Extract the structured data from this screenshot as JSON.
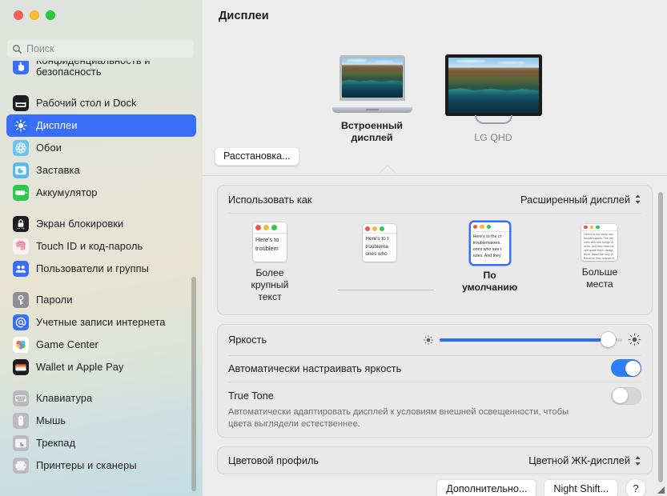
{
  "window": {
    "traffic_lights": [
      "close",
      "minimize",
      "zoom"
    ],
    "colors": {
      "accent": "#3b6ef6",
      "slider": "#2f6ef0",
      "toggle_on": "#2f7ef5"
    }
  },
  "search": {
    "placeholder": "Поиск",
    "value": "",
    "icon": "search-icon"
  },
  "sidebar": {
    "groups": [
      {
        "items": [
          {
            "label": "Конфиденциальность и безопасность",
            "icon": "hand-raised-icon",
            "selected": false,
            "clipped": true
          }
        ]
      },
      {
        "items": [
          {
            "label": "Рабочий стол и Dock",
            "icon": "dock-icon",
            "selected": false
          },
          {
            "label": "Дисплеи",
            "icon": "brightness-icon",
            "selected": true
          },
          {
            "label": "Обои",
            "icon": "wallpaper-icon",
            "selected": false
          },
          {
            "label": "Заставка",
            "icon": "screensaver-icon",
            "selected": false
          },
          {
            "label": "Аккумулятор",
            "icon": "battery-icon",
            "selected": false
          }
        ]
      },
      {
        "items": [
          {
            "label": "Экран блокировки",
            "icon": "lock-screen-icon",
            "selected": false
          },
          {
            "label": "Touch ID и код-пароль",
            "icon": "touch-id-icon",
            "selected": false
          },
          {
            "label": "Пользователи и группы",
            "icon": "users-icon",
            "selected": false
          }
        ]
      },
      {
        "items": [
          {
            "label": "Пароли",
            "icon": "key-icon",
            "selected": false
          },
          {
            "label": "Учетные записи интернета",
            "icon": "at-sign-icon",
            "selected": false
          },
          {
            "label": "Game Center",
            "icon": "game-center-icon",
            "selected": false
          },
          {
            "label": "Wallet и Apple Pay",
            "icon": "wallet-icon",
            "selected": false
          }
        ]
      },
      {
        "items": [
          {
            "label": "Клавиатура",
            "icon": "keyboard-icon",
            "selected": false
          },
          {
            "label": "Мышь",
            "icon": "mouse-icon",
            "selected": false
          },
          {
            "label": "Трекпад",
            "icon": "trackpad-icon",
            "selected": false
          },
          {
            "label": "Принтеры и сканеры",
            "icon": "printer-icon",
            "selected": false
          }
        ]
      }
    ]
  },
  "main": {
    "title": "Дисплеи",
    "arrange_button": "Расстановка...",
    "displays": [
      {
        "name": "Встроенный дисплей",
        "type": "laptop",
        "active": true
      },
      {
        "name": "LG QHD",
        "type": "monitor",
        "active": false
      }
    ],
    "use_as": {
      "label": "Использовать как",
      "value": "Расширенный дисплей",
      "options": [
        "Расширенный дисплей"
      ]
    },
    "scale_options": [
      {
        "caption": "Более\nкрупный\nтекст",
        "selected": false,
        "preview_text": "Here's to\ntroublem",
        "size": "xl"
      },
      {
        "caption": "",
        "selected": false,
        "preview_text": "Here's to t\ntroublema\nones who",
        "size": "l"
      },
      {
        "caption": "По умолчанию",
        "selected": true,
        "preview_text": "Here's to the cr\ntroublemakers.\nones who see t\nrules. And they",
        "size": "m"
      },
      {
        "caption": "Больше\nместа",
        "selected": false,
        "preview_text": "Here's to the crazy one\ntroublemakers. The rou\nones who see things di\nrules. And they have no\ncan quote them, disagr\nthem. About the only th\nBecause they change th",
        "size": "s"
      }
    ],
    "brightness": {
      "label": "Яркость",
      "value": 96,
      "min": 0,
      "max": 100,
      "icon_low": "sun-small-icon",
      "icon_high": "sun-large-icon"
    },
    "auto_brightness": {
      "label": "Автоматически настраивать яркость",
      "on": true
    },
    "true_tone": {
      "label": "True Tone",
      "description": "Автоматически адаптировать дисплей к условиям внешней освещенности, чтобы цвета выглядели естественнее.",
      "on": false
    },
    "color_profile": {
      "label": "Цветовой профиль",
      "value": "Цветной ЖК-дисплей",
      "options": [
        "Цветной ЖК-дисплей"
      ]
    },
    "buttons": [
      {
        "label": "Дополнительно...",
        "name": "advanced-button"
      },
      {
        "label": "Night Shift...",
        "name": "night-shift-button"
      },
      {
        "label": "?",
        "name": "help-button"
      }
    ]
  }
}
